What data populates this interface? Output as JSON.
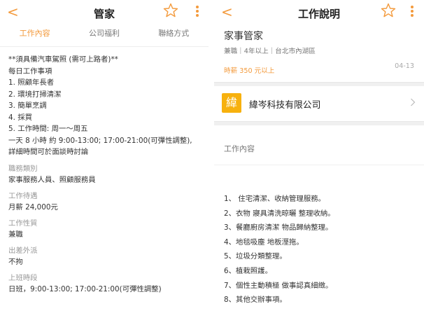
{
  "left": {
    "nav": {
      "back": "<",
      "title": "管家"
    },
    "tabs": [
      {
        "label": "工作內容",
        "active": true
      },
      {
        "label": "公司福利",
        "active": false
      },
      {
        "label": "聯絡方式",
        "active": false
      }
    ],
    "description": [
      "**須具備汽車駕照 (需可上路者)**",
      "每日工作事項",
      "1. 照顧年長者",
      "2. 環境打掃清潔",
      "3. 簡單烹調",
      "4. 採買",
      "5. 工作時間: 周一～周五",
      "一天 8 小時 約 9:00-13:00; 17:00-21:00(可彈性調整),",
      "詳細時間可於面談時討論"
    ],
    "fields": [
      {
        "label": "職務類別",
        "value": "家事服務人員、照顧服務員"
      },
      {
        "label": "工作待遇",
        "value": "月薪 24,000元"
      },
      {
        "label": "工作性質",
        "value": "兼職"
      },
      {
        "label": "出差外派",
        "value": "不拘"
      },
      {
        "label": "上班時段",
        "value": "日班，9:00-13:00; 17:00-21:00(可彈性調整)"
      }
    ]
  },
  "right": {
    "nav": {
      "back": "<",
      "title": "工作說明"
    },
    "job_title": "家事管家",
    "meta": "兼職｜4年以上｜台北市內湖區",
    "salary": "時薪 350 元以上",
    "date": "04-13",
    "company": {
      "logo_char": "緯",
      "name": "緯岑科技有限公司"
    },
    "section_title": "工作內容",
    "duties": [
      "1、 住宅清潔、收納管理服務。",
      "2、衣物 寢具清洗晾曬 整理收納。",
      "3、餐廳廚房清潔 物品歸納整理。",
      "4、地毯吸塵 地板溼拖。",
      "5、垃圾分類整理。",
      "6、植栽照護。",
      "7、個性主動積極  做事認真細緻。",
      "8、其他交辦事項。"
    ]
  },
  "colors": {
    "accent": "#f39a3c",
    "logo_bg": "#f7b10e"
  },
  "icons": [
    "back-chevron-icon",
    "star-outline-icon",
    "kebab-menu-icon",
    "chevron-right-icon"
  ]
}
